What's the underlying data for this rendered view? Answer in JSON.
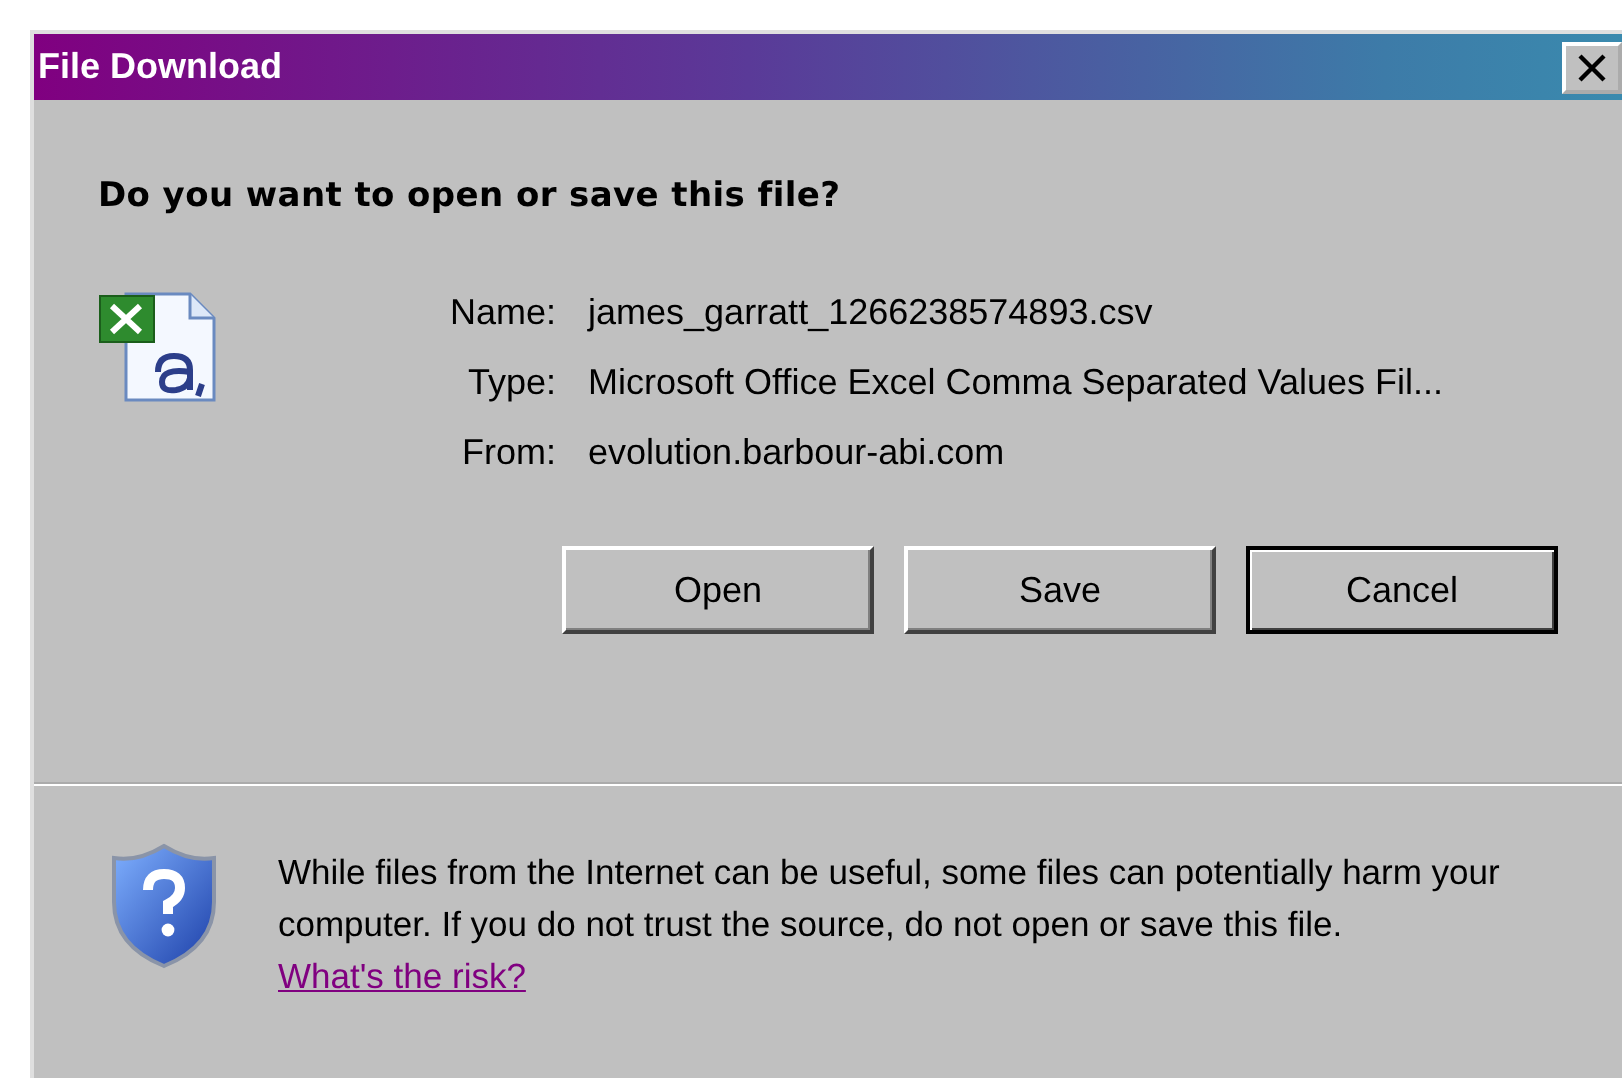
{
  "window": {
    "title": "File Download"
  },
  "question": "Do you want to open or save this file?",
  "file_info": [
    {
      "label": "Name:",
      "value": "james_garratt_1266238574893.csv"
    },
    {
      "label": "Type:",
      "value": "Microsoft Office Excel Comma Separated Values Fil..."
    },
    {
      "label": "From:",
      "value": "evolution.barbour-abi.com"
    }
  ],
  "buttons": [
    {
      "label": "Open",
      "default": false
    },
    {
      "label": "Save",
      "default": false
    },
    {
      "label": "Cancel",
      "default": true
    }
  ],
  "warning": {
    "text": "While files from the Internet can be useful, some files can potentially harm your computer. If you do not trust the source, do not open or save this file.",
    "link": "What's the risk?"
  }
}
